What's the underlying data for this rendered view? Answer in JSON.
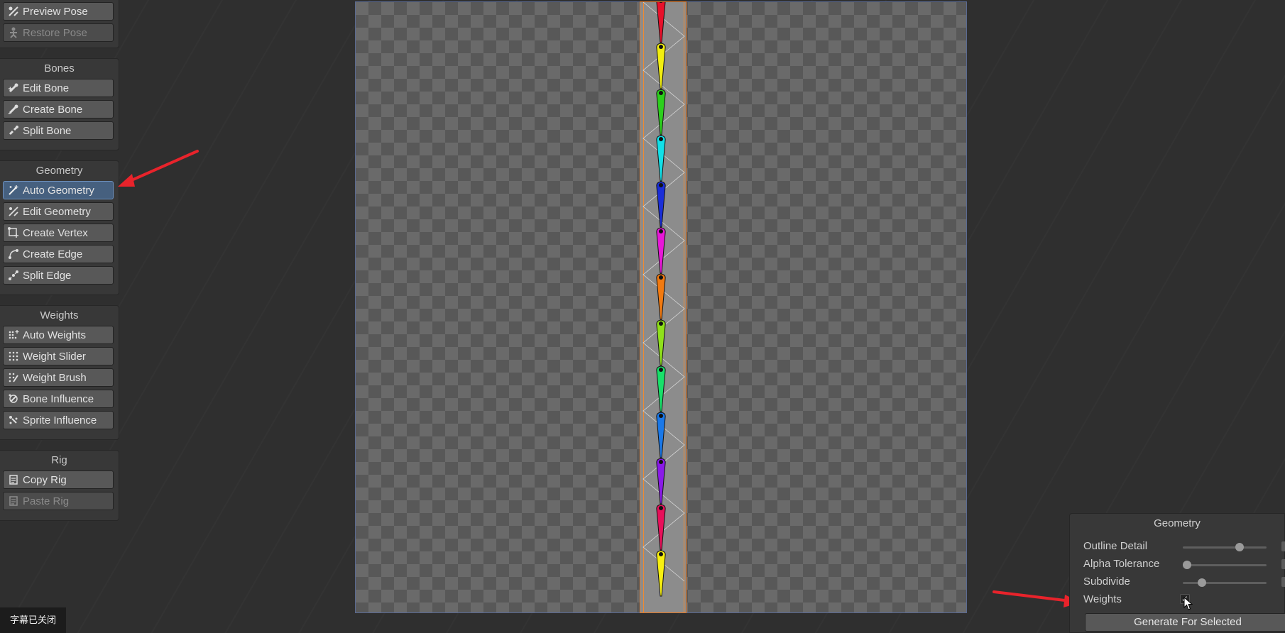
{
  "pose_group": {
    "buttons": [
      {
        "label": "Preview Pose",
        "icon": "preview-pose-icon"
      },
      {
        "label": "Restore Pose",
        "icon": "restore-pose-icon",
        "disabled": true
      }
    ]
  },
  "bones_group": {
    "title": "Bones",
    "buttons": [
      {
        "label": "Edit Bone",
        "icon": "edit-bone-icon"
      },
      {
        "label": "Create Bone",
        "icon": "create-bone-icon"
      },
      {
        "label": "Split Bone",
        "icon": "split-bone-icon"
      }
    ]
  },
  "geometry_group": {
    "title": "Geometry",
    "buttons": [
      {
        "label": "Auto Geometry",
        "icon": "auto-geometry-icon",
        "active": true
      },
      {
        "label": "Edit Geometry",
        "icon": "edit-geometry-icon"
      },
      {
        "label": "Create Vertex",
        "icon": "create-vertex-icon"
      },
      {
        "label": "Create Edge",
        "icon": "create-edge-icon"
      },
      {
        "label": "Split Edge",
        "icon": "split-edge-icon"
      }
    ]
  },
  "weights_group": {
    "title": "Weights",
    "buttons": [
      {
        "label": "Auto Weights",
        "icon": "auto-weights-icon"
      },
      {
        "label": "Weight Slider",
        "icon": "weight-slider-icon"
      },
      {
        "label": "Weight Brush",
        "icon": "weight-brush-icon"
      },
      {
        "label": "Bone Influence",
        "icon": "bone-influence-icon"
      },
      {
        "label": "Sprite Influence",
        "icon": "sprite-influence-icon"
      }
    ]
  },
  "rig_group": {
    "title": "Rig",
    "buttons": [
      {
        "label": "Copy Rig",
        "icon": "copy-rig-icon"
      },
      {
        "label": "Paste Rig",
        "icon": "paste-rig-icon",
        "disabled": true
      }
    ]
  },
  "geometry_panel": {
    "title": "Geometry",
    "outline_detail_label": "Outline Detail",
    "outline_detail_value": 0.7,
    "alpha_tolerance_label": "Alpha Tolerance",
    "alpha_tolerance_value": 0.0,
    "subdivide_label": "Subdivide",
    "subdivide_value": 0.2,
    "weights_label": "Weights",
    "weights_checked": true,
    "generate_label": "Generate For Selected"
  },
  "subtitle_status": "字幕已关闭",
  "colors": {
    "active_button": "#46607f",
    "sprite_outline": "#e07a2a",
    "annotation_arrow": "#e8232b"
  },
  "bone_colors": [
    "#e8102a",
    "#f2ee10",
    "#2ccf1c",
    "#12e0e8",
    "#1a2ed8",
    "#e818d8",
    "#f27a10",
    "#8fe01a",
    "#18e06a",
    "#1a78e8",
    "#8a1ae8",
    "#e8105a",
    "#f8f010"
  ]
}
